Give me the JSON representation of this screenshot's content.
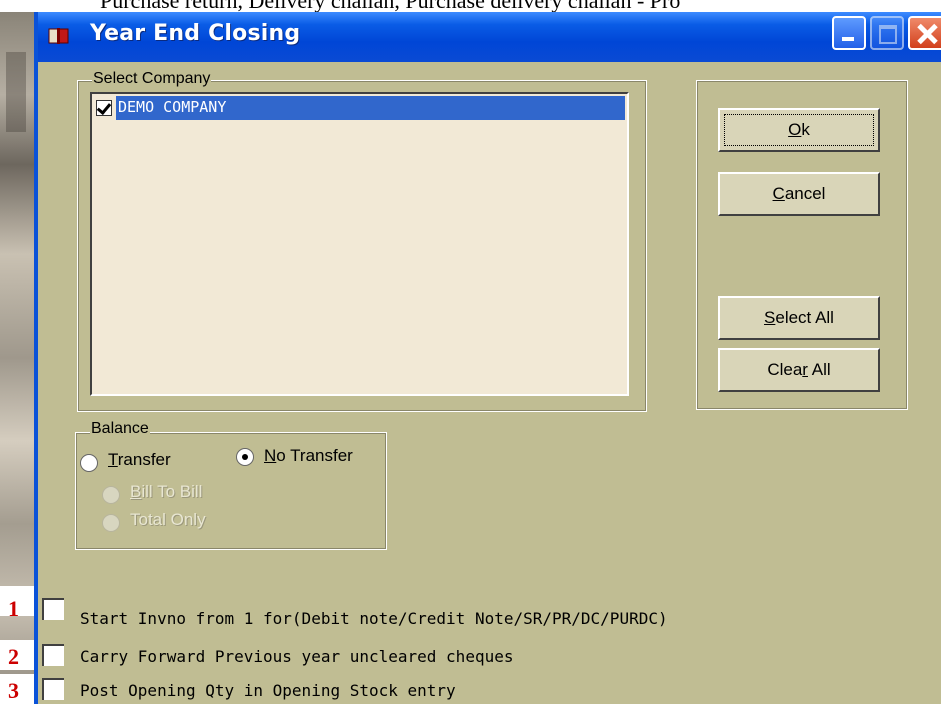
{
  "background": {
    "top_text": "Purchase return, Delivery challan, Purchase delivery challan - Pro"
  },
  "window": {
    "title": "Year End Closing",
    "icon": "book-icon",
    "controls": {
      "minimize": "minimize-icon",
      "maximize": "maximize-icon",
      "close": "close-icon"
    }
  },
  "select_company": {
    "label": "Select Company",
    "items": [
      {
        "name": "DEMO COMPANY",
        "checked": true,
        "selected": true
      }
    ]
  },
  "buttons": {
    "ok_prefix": "",
    "ok_mnemonic": "O",
    "ok_rest": "k",
    "cancel_mnemonic": "C",
    "cancel_rest": "ancel",
    "select_all_mnemonic": "S",
    "select_all_rest": "elect All",
    "clear_all_pre": "Clea",
    "clear_all_mnemonic": "r",
    "clear_all_rest": " All"
  },
  "balance": {
    "label": "Balance",
    "transfer_mnemonic": "T",
    "transfer_rest": "ransfer",
    "no_transfer_mnemonic": "N",
    "no_transfer_rest": "o Transfer",
    "selected": "No Transfer",
    "bill_to_bill_mnemonic": "B",
    "bill_to_bill_rest": "ill To Bill",
    "total_only": "Total Only"
  },
  "options": [
    {
      "number": "1",
      "label": "Start Invno from 1 for(Debit note/Credit Note/SR/PR/DC/PURDC)",
      "checked": false
    },
    {
      "number": "2",
      "label": "Carry Forward Previous year uncleared cheques",
      "checked": false
    },
    {
      "number": "3",
      "label": "Post Opening Qty in Opening Stock entry",
      "checked": false
    }
  ],
  "colors": {
    "dialog_bg": "#c0bd93",
    "titlebar": "#0a52d8",
    "selection": "#3167cc",
    "list_bg": "#f2e9d6",
    "number_red": "#cc0000"
  }
}
